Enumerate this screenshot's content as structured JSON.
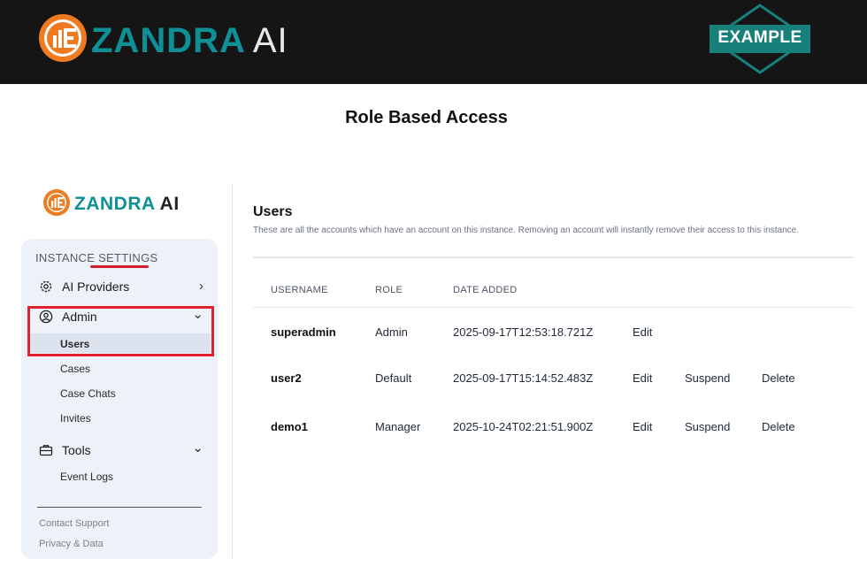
{
  "banner": {
    "brand": "ZANDRA",
    "brand_ai": "AI",
    "badge": "EXAMPLE",
    "colors": {
      "orange": "#ef7a1f",
      "teal": "#0f8f96",
      "badge_teal": "#18807a"
    }
  },
  "page_heading": "Role Based Access",
  "sidebar": {
    "logo_text": "ZANDRA",
    "logo_ai": "AI",
    "section_label": "INSTANCE SETTINGS",
    "items": [
      {
        "label": "AI Providers",
        "icon": "gear-icon",
        "chevron": "›"
      },
      {
        "label": "Admin",
        "icon": "user-circle-icon",
        "chevron": "⌄"
      },
      {
        "label": "Tools",
        "icon": "briefcase-icon",
        "chevron": "⌄"
      }
    ],
    "admin_subitems": [
      "Users",
      "Cases",
      "Case Chats",
      "Invites"
    ],
    "tools_subitems": [
      "Event Logs"
    ],
    "footer": [
      "Contact Support",
      "Privacy & Data"
    ]
  },
  "main": {
    "title": "Users",
    "description": "These are all the accounts which have an account on this instance. Removing an account will instantly remove their access to this instance.",
    "columns": [
      "USERNAME",
      "ROLE",
      "DATE ADDED"
    ],
    "rows": [
      {
        "username": "superadmin",
        "role": "Admin",
        "date_added": "2025-09-17T12:53:18.721Z",
        "actions": [
          "Edit"
        ]
      },
      {
        "username": "user2",
        "role": "Default",
        "date_added": "2025-09-17T15:14:52.483Z",
        "actions": [
          "Edit",
          "Suspend",
          "Delete"
        ]
      },
      {
        "username": "demo1",
        "role": "Manager",
        "date_added": "2025-10-24T02:21:51.900Z",
        "actions": [
          "Edit",
          "Suspend",
          "Delete"
        ]
      }
    ]
  }
}
